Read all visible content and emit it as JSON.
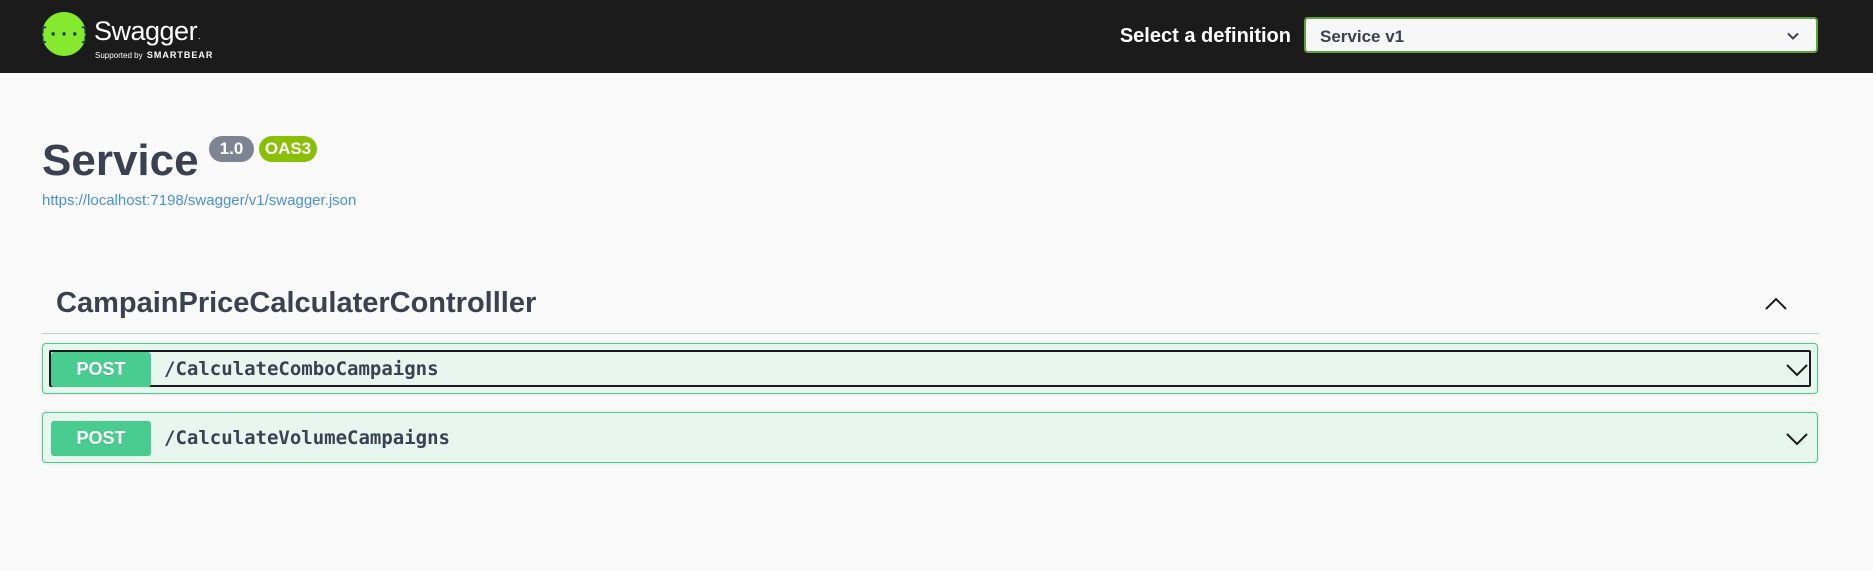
{
  "topbar": {
    "logo": {
      "name": "Swagger",
      "trademark": ".",
      "supported_by": "Supported by",
      "brand": "SMARTBEAR",
      "icon": "swagger-braces-icon",
      "color": "#85ea2d"
    },
    "definition": {
      "label": "Select a definition",
      "selected": "Service v1",
      "icon": "chevron-down-icon"
    }
  },
  "info": {
    "title": "Service",
    "version_badge": "1.0",
    "oas_badge": "OAS3",
    "spec_url": "https://localhost:7198/swagger/v1/swagger.json"
  },
  "tag": {
    "name": "CampainPriceCalculaterControlller",
    "toggle_icon": "chevron-up-icon",
    "operations": [
      {
        "method": "POST",
        "path": "/CalculateComboCampaigns",
        "icon": "chevron-down-icon"
      },
      {
        "method": "POST",
        "path": "/CalculateVolumeCampaigns",
        "icon": "chevron-down-icon"
      }
    ]
  },
  "colors": {
    "topbar_bg": "#1b1b1b",
    "post_green": "#49cc90",
    "post_bg": "#e8f6f0",
    "select_border": "#62a03f",
    "version_badge": "#7d8492",
    "oas_badge": "#89bf04",
    "link": "#4990e2",
    "text": "#3b4151"
  }
}
